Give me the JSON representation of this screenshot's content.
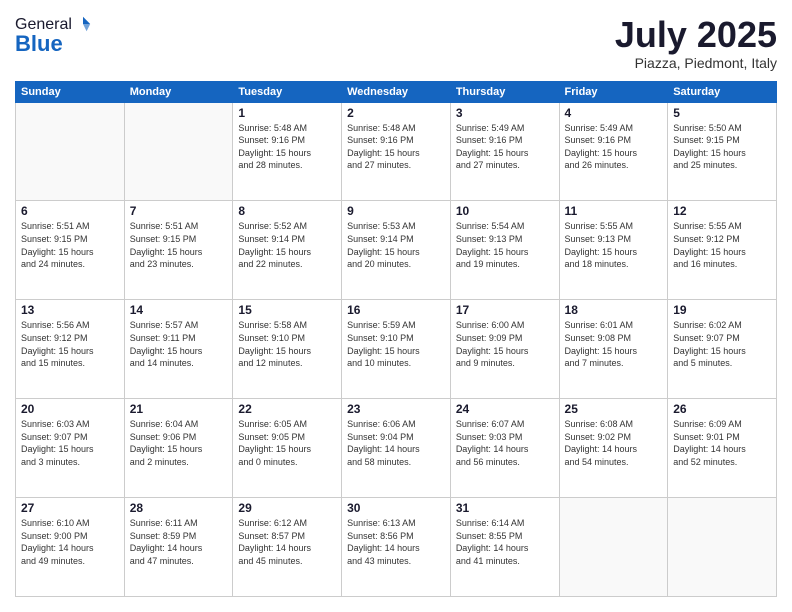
{
  "header": {
    "logo_general": "General",
    "logo_blue": "Blue",
    "month_title": "July 2025",
    "location": "Piazza, Piedmont, Italy"
  },
  "days_of_week": [
    "Sunday",
    "Monday",
    "Tuesday",
    "Wednesday",
    "Thursday",
    "Friday",
    "Saturday"
  ],
  "weeks": [
    [
      {
        "day": "",
        "info": ""
      },
      {
        "day": "",
        "info": ""
      },
      {
        "day": "1",
        "info": "Sunrise: 5:48 AM\nSunset: 9:16 PM\nDaylight: 15 hours\nand 28 minutes."
      },
      {
        "day": "2",
        "info": "Sunrise: 5:48 AM\nSunset: 9:16 PM\nDaylight: 15 hours\nand 27 minutes."
      },
      {
        "day": "3",
        "info": "Sunrise: 5:49 AM\nSunset: 9:16 PM\nDaylight: 15 hours\nand 27 minutes."
      },
      {
        "day": "4",
        "info": "Sunrise: 5:49 AM\nSunset: 9:16 PM\nDaylight: 15 hours\nand 26 minutes."
      },
      {
        "day": "5",
        "info": "Sunrise: 5:50 AM\nSunset: 9:15 PM\nDaylight: 15 hours\nand 25 minutes."
      }
    ],
    [
      {
        "day": "6",
        "info": "Sunrise: 5:51 AM\nSunset: 9:15 PM\nDaylight: 15 hours\nand 24 minutes."
      },
      {
        "day": "7",
        "info": "Sunrise: 5:51 AM\nSunset: 9:15 PM\nDaylight: 15 hours\nand 23 minutes."
      },
      {
        "day": "8",
        "info": "Sunrise: 5:52 AM\nSunset: 9:14 PM\nDaylight: 15 hours\nand 22 minutes."
      },
      {
        "day": "9",
        "info": "Sunrise: 5:53 AM\nSunset: 9:14 PM\nDaylight: 15 hours\nand 20 minutes."
      },
      {
        "day": "10",
        "info": "Sunrise: 5:54 AM\nSunset: 9:13 PM\nDaylight: 15 hours\nand 19 minutes."
      },
      {
        "day": "11",
        "info": "Sunrise: 5:55 AM\nSunset: 9:13 PM\nDaylight: 15 hours\nand 18 minutes."
      },
      {
        "day": "12",
        "info": "Sunrise: 5:55 AM\nSunset: 9:12 PM\nDaylight: 15 hours\nand 16 minutes."
      }
    ],
    [
      {
        "day": "13",
        "info": "Sunrise: 5:56 AM\nSunset: 9:12 PM\nDaylight: 15 hours\nand 15 minutes."
      },
      {
        "day": "14",
        "info": "Sunrise: 5:57 AM\nSunset: 9:11 PM\nDaylight: 15 hours\nand 14 minutes."
      },
      {
        "day": "15",
        "info": "Sunrise: 5:58 AM\nSunset: 9:10 PM\nDaylight: 15 hours\nand 12 minutes."
      },
      {
        "day": "16",
        "info": "Sunrise: 5:59 AM\nSunset: 9:10 PM\nDaylight: 15 hours\nand 10 minutes."
      },
      {
        "day": "17",
        "info": "Sunrise: 6:00 AM\nSunset: 9:09 PM\nDaylight: 15 hours\nand 9 minutes."
      },
      {
        "day": "18",
        "info": "Sunrise: 6:01 AM\nSunset: 9:08 PM\nDaylight: 15 hours\nand 7 minutes."
      },
      {
        "day": "19",
        "info": "Sunrise: 6:02 AM\nSunset: 9:07 PM\nDaylight: 15 hours\nand 5 minutes."
      }
    ],
    [
      {
        "day": "20",
        "info": "Sunrise: 6:03 AM\nSunset: 9:07 PM\nDaylight: 15 hours\nand 3 minutes."
      },
      {
        "day": "21",
        "info": "Sunrise: 6:04 AM\nSunset: 9:06 PM\nDaylight: 15 hours\nand 2 minutes."
      },
      {
        "day": "22",
        "info": "Sunrise: 6:05 AM\nSunset: 9:05 PM\nDaylight: 15 hours\nand 0 minutes."
      },
      {
        "day": "23",
        "info": "Sunrise: 6:06 AM\nSunset: 9:04 PM\nDaylight: 14 hours\nand 58 minutes."
      },
      {
        "day": "24",
        "info": "Sunrise: 6:07 AM\nSunset: 9:03 PM\nDaylight: 14 hours\nand 56 minutes."
      },
      {
        "day": "25",
        "info": "Sunrise: 6:08 AM\nSunset: 9:02 PM\nDaylight: 14 hours\nand 54 minutes."
      },
      {
        "day": "26",
        "info": "Sunrise: 6:09 AM\nSunset: 9:01 PM\nDaylight: 14 hours\nand 52 minutes."
      }
    ],
    [
      {
        "day": "27",
        "info": "Sunrise: 6:10 AM\nSunset: 9:00 PM\nDaylight: 14 hours\nand 49 minutes."
      },
      {
        "day": "28",
        "info": "Sunrise: 6:11 AM\nSunset: 8:59 PM\nDaylight: 14 hours\nand 47 minutes."
      },
      {
        "day": "29",
        "info": "Sunrise: 6:12 AM\nSunset: 8:57 PM\nDaylight: 14 hours\nand 45 minutes."
      },
      {
        "day": "30",
        "info": "Sunrise: 6:13 AM\nSunset: 8:56 PM\nDaylight: 14 hours\nand 43 minutes."
      },
      {
        "day": "31",
        "info": "Sunrise: 6:14 AM\nSunset: 8:55 PM\nDaylight: 14 hours\nand 41 minutes."
      },
      {
        "day": "",
        "info": ""
      },
      {
        "day": "",
        "info": ""
      }
    ]
  ]
}
